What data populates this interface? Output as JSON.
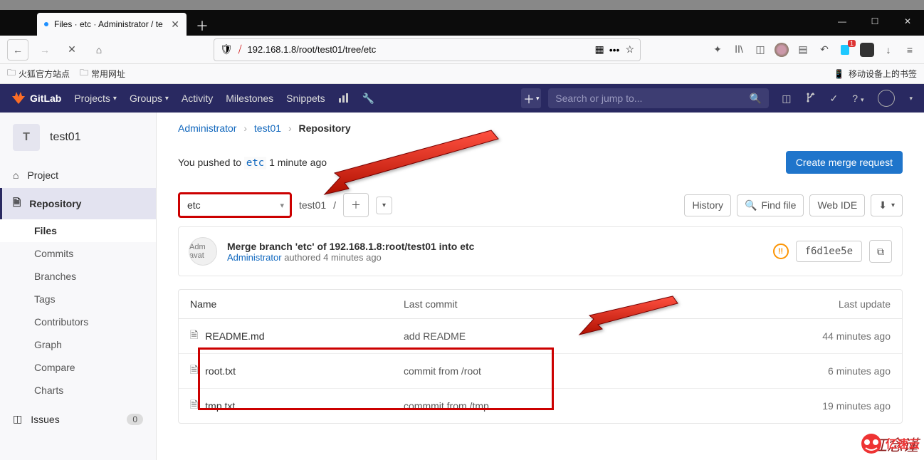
{
  "browser": {
    "tab_title": "Files · etc · Administrator / te",
    "url_display": "192.168.1.8/root/test01/tree/etc",
    "bookmarks": {
      "b1": "火狐官方站点",
      "b2": "常用网址",
      "right": "移动设备上的书签"
    }
  },
  "gitlab_nav": {
    "brand": "GitLab",
    "projects": "Projects",
    "groups": "Groups",
    "activity": "Activity",
    "milestones": "Milestones",
    "snippets": "Snippets",
    "search_placeholder": "Search or jump to..."
  },
  "sidebar": {
    "avatar_letter": "T",
    "project_name": "test01",
    "items": [
      {
        "label": "Project"
      },
      {
        "label": "Repository"
      },
      {
        "label": "Issues",
        "badge": "0"
      }
    ],
    "subs": [
      {
        "label": "Files"
      },
      {
        "label": "Commits"
      },
      {
        "label": "Branches"
      },
      {
        "label": "Tags"
      },
      {
        "label": "Contributors"
      },
      {
        "label": "Graph"
      },
      {
        "label": "Compare"
      },
      {
        "label": "Charts"
      }
    ]
  },
  "breadcrumb": {
    "a1": "Administrator",
    "a2": "test01",
    "a3": "Repository"
  },
  "push_banner": {
    "prefix": "You pushed to ",
    "branch": "etc",
    "suffix": " 1 minute ago",
    "btn": "Create merge request"
  },
  "branch_selector": "etc",
  "path": {
    "root": "test01",
    "sep": "/"
  },
  "toolbar": {
    "history": "History",
    "find": "Find file",
    "webide": "Web IDE"
  },
  "commit": {
    "avatar": "Adm  avat",
    "title": "Merge branch 'etc' of 192.168.1.8:root/test01 into etc",
    "author": "Administrator",
    "authored": " authored 4 minutes ago",
    "sha": "f6d1ee5e"
  },
  "table": {
    "col_name": "Name",
    "col_commit": "Last commit",
    "col_update": "Last update",
    "rows": [
      {
        "name": "README.md",
        "commit": "add README",
        "update": "44 minutes ago"
      },
      {
        "name": "root.txt",
        "commit": "commit from /root",
        "update": "6 minutes ago"
      },
      {
        "name": "tmp.txt",
        "commit": "commmit from /tmp",
        "update": "19 minutes ago"
      }
    ]
  },
  "watermark": "江念谨",
  "corner_brand": "亿速云"
}
